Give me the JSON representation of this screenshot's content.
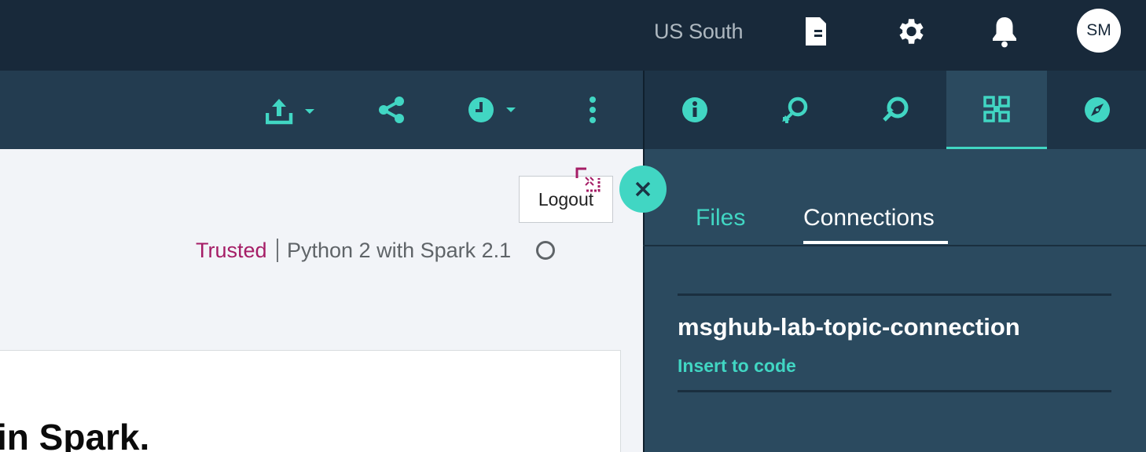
{
  "topbar": {
    "region": "US South",
    "icons": [
      "document-icon",
      "gear-icon",
      "bell-icon"
    ],
    "avatar_initials": "SM"
  },
  "toolbar": {
    "icons": [
      "upload-icon",
      "share-icon",
      "clock-icon",
      "more-vertical-icon"
    ]
  },
  "right_tabs": {
    "icons": [
      "info-icon",
      "undo-icon",
      "find-replace-icon",
      "data-icon",
      "compass-icon"
    ],
    "active": "data-icon"
  },
  "notebook": {
    "logout_label": "Logout",
    "trusted_label": "Trusted",
    "kernel_name": "Python 2 with Spark 2.1",
    "cell_text": "in Spark."
  },
  "panel": {
    "tabs": [
      "Files",
      "Connections"
    ],
    "active_tab": "Connections",
    "connections": [
      {
        "name": "msghub-lab-topic-connection",
        "action": "Insert to code"
      }
    ]
  },
  "colors": {
    "accent": "#41d6c3",
    "trusted": "#a51d66",
    "topbar_bg": "#18293a",
    "toolbar_bg": "#233c50",
    "panel_bg": "#2b4a5f"
  }
}
